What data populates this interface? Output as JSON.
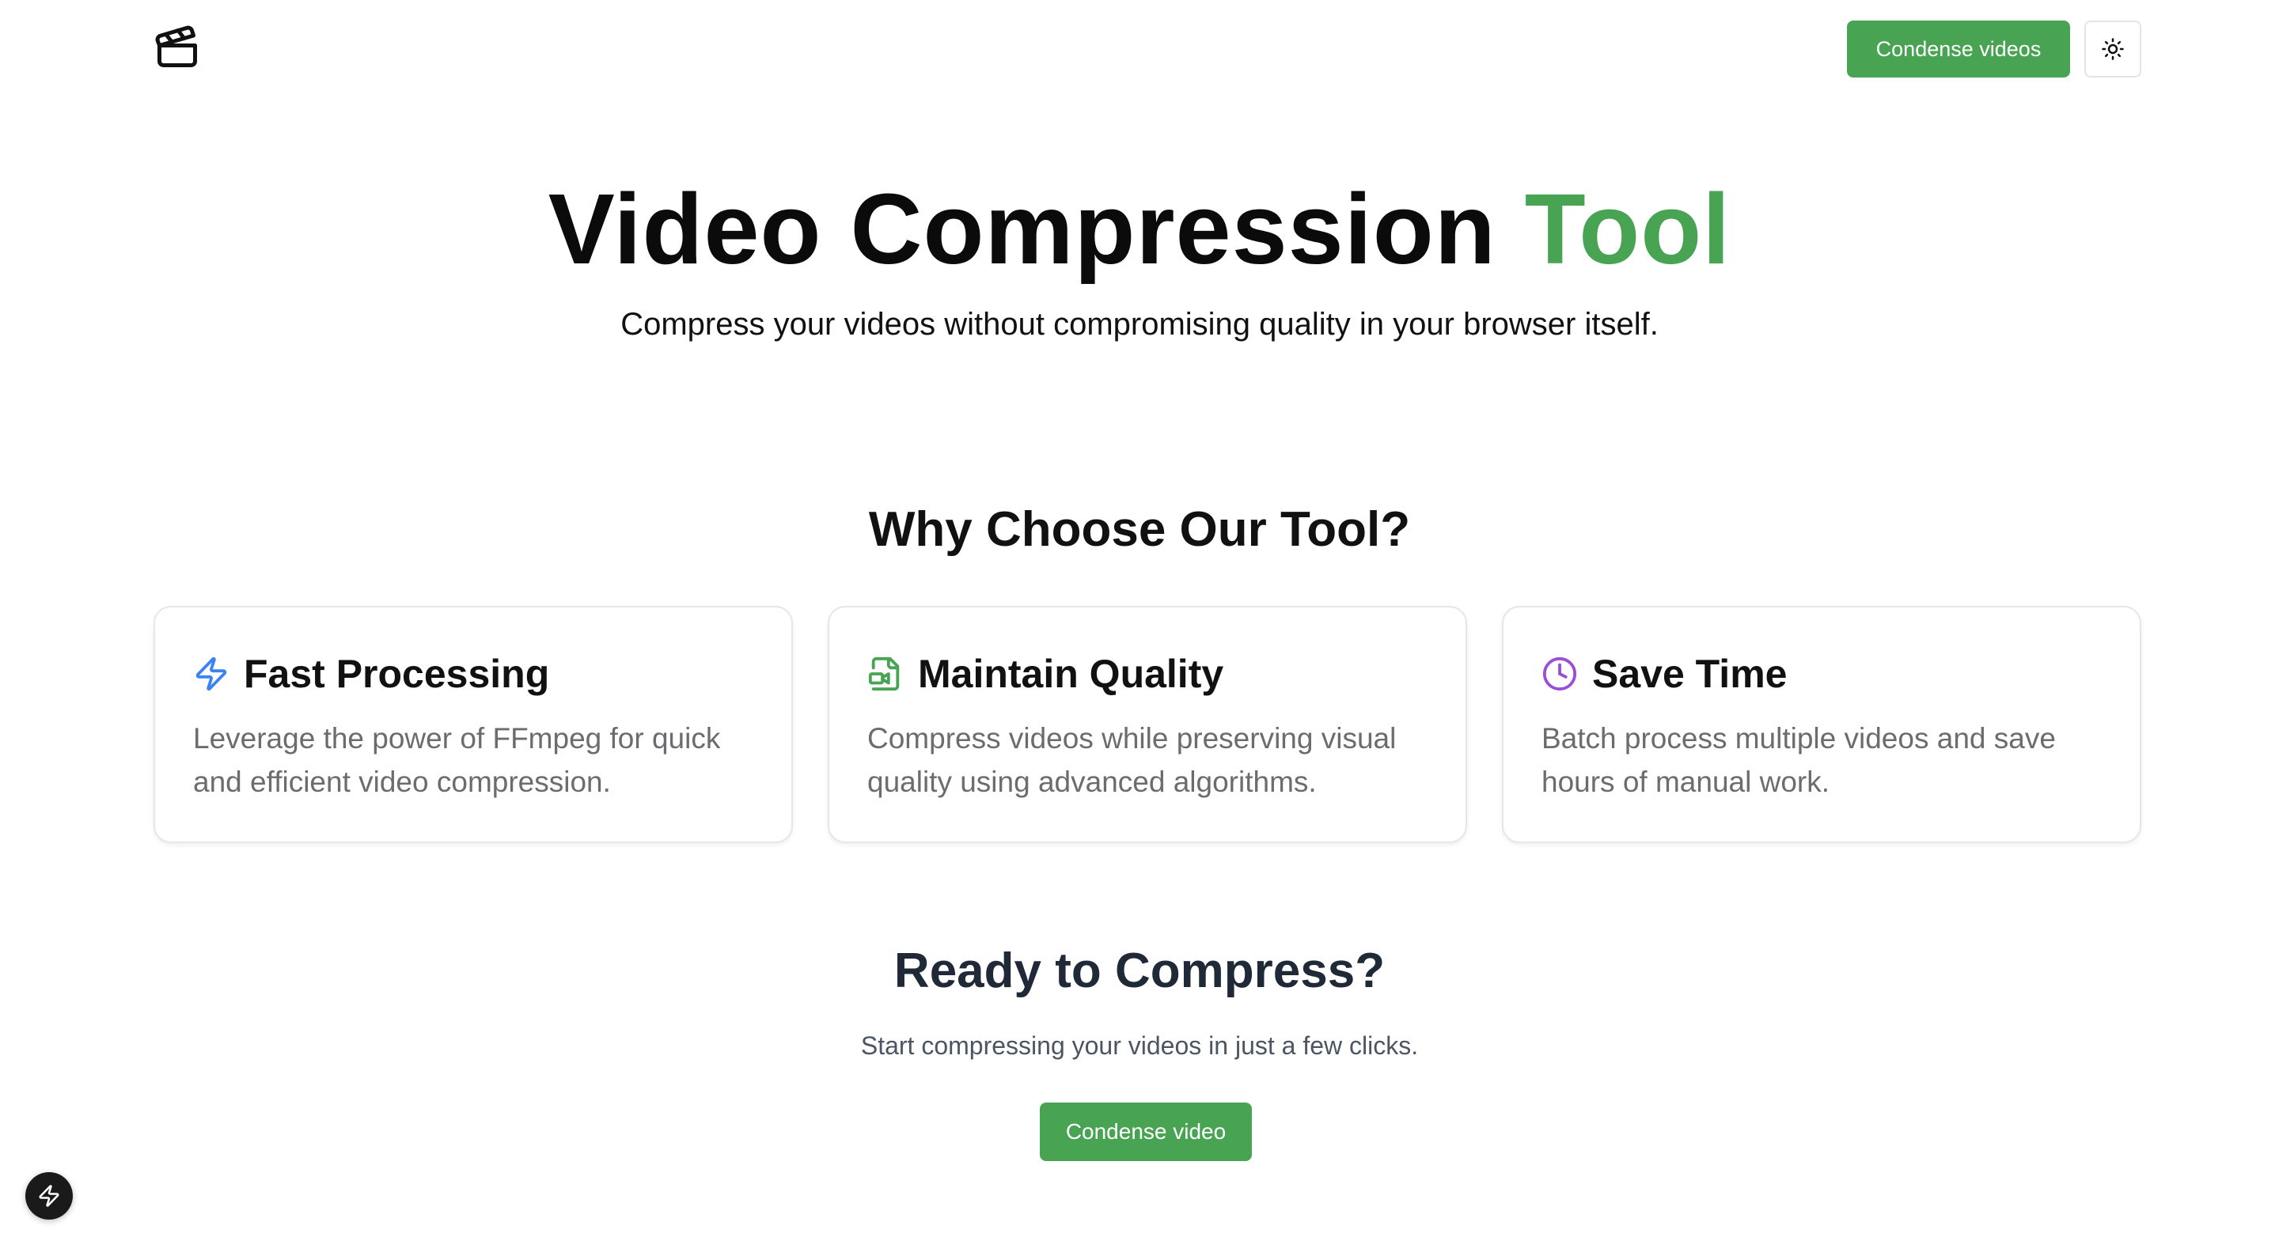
{
  "header": {
    "logo_icon": "clapperboard-icon",
    "cta_label": "Condense videos",
    "theme_toggle_icon": "sun-icon"
  },
  "hero": {
    "title_main": "Video Compression ",
    "title_accent": "Tool",
    "subtitle": "Compress your videos without compromising quality in your browser itself."
  },
  "features": {
    "heading": "Why Choose Our Tool?",
    "cards": [
      {
        "icon": "zap-icon",
        "icon_color": "#3b82f6",
        "title": "Fast Processing",
        "description": "Leverage the power of FFmpeg for quick and efficient video compression."
      },
      {
        "icon": "file-video-icon",
        "icon_color": "#48a352",
        "title": "Maintain Quality",
        "description": "Compress videos while preserving visual quality using advanced algorithms."
      },
      {
        "icon": "clock-icon",
        "icon_color": "#9b4fd6",
        "title": "Save Time",
        "description": "Batch process multiple videos and save hours of manual work."
      }
    ]
  },
  "ready": {
    "heading": "Ready to Compress?",
    "subtitle": "Start compressing your videos in just a few clicks.",
    "cta_label": "Condense video"
  },
  "dev_badge": {
    "icon": "lightning-icon"
  },
  "colors": {
    "accent": "#48a352",
    "text": "#111111",
    "muted": "#6b6b70",
    "border": "#e6e6e6"
  }
}
